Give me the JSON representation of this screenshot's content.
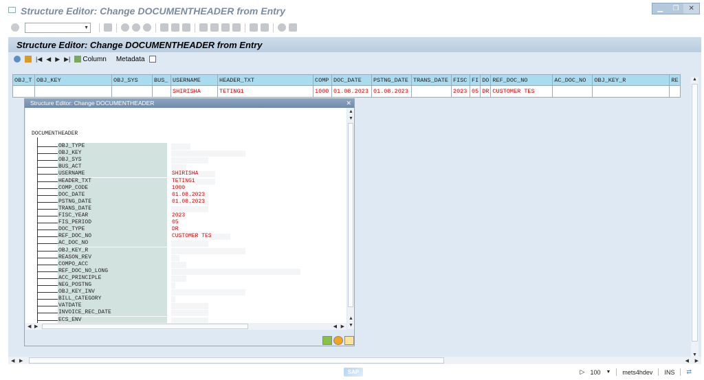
{
  "window": {
    "title": "Structure Editor: Change DOCUMENTHEADER from Entry"
  },
  "command_field": {
    "value": ""
  },
  "app": {
    "title": "Structure Editor: Change DOCUMENTHEADER from Entry",
    "toolbar": {
      "column_label": "Column",
      "metadata_label": "Metadata"
    }
  },
  "grid": {
    "columns": [
      "OBJ_T",
      "OBJ_KEY",
      "OBJ_SYS",
      "BUS_",
      "USERNAME",
      "HEADER_TXT",
      "COMP",
      "DOC_DATE",
      "PSTNG_DATE",
      "TRANS_DATE",
      "FISC",
      "FI",
      "DO",
      "REF_DOC_NO",
      "AC_DOC_NO",
      "OBJ_KEY_R",
      "RE"
    ],
    "row": [
      "",
      "",
      "",
      "",
      "SHIRISHA",
      "TETING1",
      "1000",
      "01.08.2023",
      "01.08.2023",
      "",
      "2023",
      "05",
      "DR",
      "CUSTOMER TES",
      "",
      "",
      ""
    ]
  },
  "popup": {
    "title": "Structure Editor: Change DOCUMENTHEADER",
    "root": "DOCUMENTHEADER",
    "fields": [
      {
        "name": "OBJ_TYPE",
        "value": ""
      },
      {
        "name": "OBJ_KEY",
        "value": ""
      },
      {
        "name": "OBJ_SYS",
        "value": ""
      },
      {
        "name": "BUS_ACT",
        "value": ""
      },
      {
        "name": "USERNAME",
        "value": "SHIRISHA"
      },
      {
        "name": "HEADER_TXT",
        "value": "TETING1"
      },
      {
        "name": "COMP_CODE",
        "value": "1000"
      },
      {
        "name": "DOC_DATE",
        "value": "01.08.2023"
      },
      {
        "name": "PSTNG_DATE",
        "value": "01.08.2023"
      },
      {
        "name": "TRANS_DATE",
        "value": ""
      },
      {
        "name": "FISC_YEAR",
        "value": "2023"
      },
      {
        "name": "FIS_PERIOD",
        "value": "05"
      },
      {
        "name": "DOC_TYPE",
        "value": "DR"
      },
      {
        "name": "REF_DOC_NO",
        "value": "CUSTOMER TES"
      },
      {
        "name": "AC_DOC_NO",
        "value": ""
      },
      {
        "name": "OBJ_KEY_R",
        "value": ""
      },
      {
        "name": "REASON_REV",
        "value": ""
      },
      {
        "name": "COMPO_ACC",
        "value": ""
      },
      {
        "name": "REF_DOC_NO_LONG",
        "value": ""
      },
      {
        "name": "ACC_PRINCIPLE",
        "value": ""
      },
      {
        "name": "NEG_POSTNG",
        "value": ""
      },
      {
        "name": "OBJ_KEY_INV",
        "value": ""
      },
      {
        "name": "BILL_CATEGORY",
        "value": ""
      },
      {
        "name": "VATDATE",
        "value": ""
      },
      {
        "name": "INVOICE_REC_DATE",
        "value": ""
      },
      {
        "name": "ECS_ENV",
        "value": ""
      }
    ]
  },
  "status": {
    "logo": "SAP",
    "zoom": "100",
    "system": "mets4hdev",
    "mode": "INS"
  }
}
